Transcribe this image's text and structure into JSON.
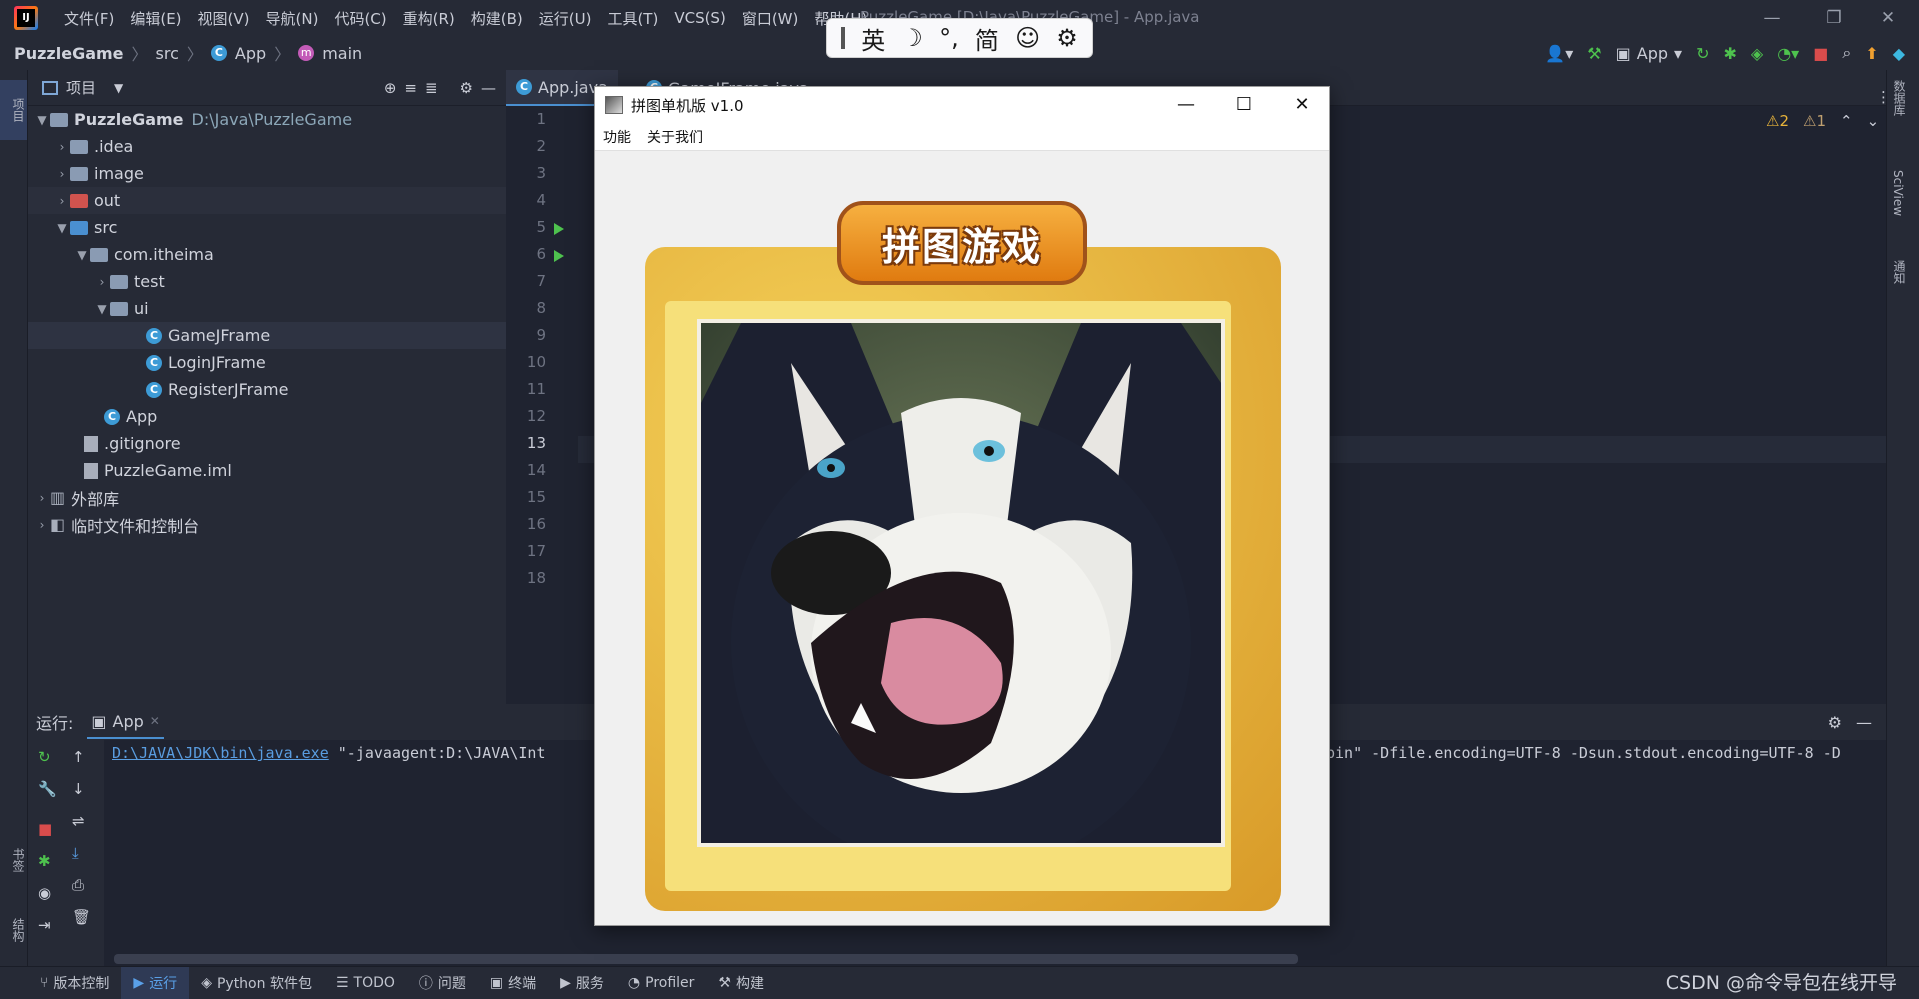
{
  "menubar": {
    "items": [
      "文件(F)",
      "编辑(E)",
      "视图(V)",
      "导航(N)",
      "代码(C)",
      "重构(R)",
      "构建(B)",
      "运行(U)",
      "工具(T)",
      "VCS(S)",
      "窗口(W)",
      "帮助(H)"
    ],
    "title": "PuzzleGame [D:\\Java\\PuzzleGame] - App.java"
  },
  "ime": {
    "mode": "英",
    "moon": "☽",
    "punct": "°,",
    "simplified": "简",
    "emoji": "☺",
    "settings": "⚙"
  },
  "navbar": {
    "project": "PuzzleGame",
    "src": "src",
    "cls": "App",
    "method": "main"
  },
  "toolbar": {
    "run_config": "App"
  },
  "project_panel": {
    "title": "项目",
    "tree": [
      {
        "label": "PuzzleGame",
        "path": "D:\\Java\\PuzzleGame"
      },
      {
        "label": ".idea"
      },
      {
        "label": "image"
      },
      {
        "label": "out"
      },
      {
        "label": "src"
      },
      {
        "label": "com.itheima"
      },
      {
        "label": "test"
      },
      {
        "label": "ui"
      },
      {
        "label": "GameJFrame"
      },
      {
        "label": "LoginJFrame"
      },
      {
        "label": "RegisterJFrame"
      },
      {
        "label": "App"
      },
      {
        "label": ".gitignore"
      },
      {
        "label": "PuzzleGame.iml"
      },
      {
        "label": "外部库"
      },
      {
        "label": "临时文件和控制台"
      }
    ]
  },
  "editor": {
    "tabs": [
      "App.java",
      "GameJFrame.java"
    ],
    "line_numbers": [
      "1",
      "2",
      "3",
      "4",
      "5",
      "6",
      "7",
      "8",
      "9",
      "10",
      "11",
      "12",
      "13",
      "14",
      "15",
      "16",
      "17",
      "18"
    ],
    "current_line": "13",
    "warnings": "⚠2",
    "weak_warnings": "⚠1"
  },
  "run_panel": {
    "label": "运行:",
    "tab": "App",
    "cmd_link": "D:\\JAVA\\JDK\\bin\\java.exe",
    "cmd_rest": " \"-javaagent:D:\\JAVA\\Int",
    "cmd_tail": "bin\" -Dfile.encoding=UTF-8 -Dsun.stdout.encoding=UTF-8 -D"
  },
  "statusbar": {
    "items": [
      "版本控制",
      "运行",
      "Python 软件包",
      "TODO",
      "问题",
      "终端",
      "服务",
      "Profiler",
      "构建"
    ],
    "watermark": "CSDN @命令导包在线开导"
  },
  "side_tabs": {
    "left_top": "项目",
    "left_bottom1": "书签",
    "left_bottom2": "结构",
    "right1": "数据库",
    "right2": "SciView",
    "right3": "通知"
  },
  "java_window": {
    "title": "拼图单机版 v1.0",
    "menu": [
      "功能",
      "关于我们"
    ],
    "banner": "拼图游戏"
  }
}
